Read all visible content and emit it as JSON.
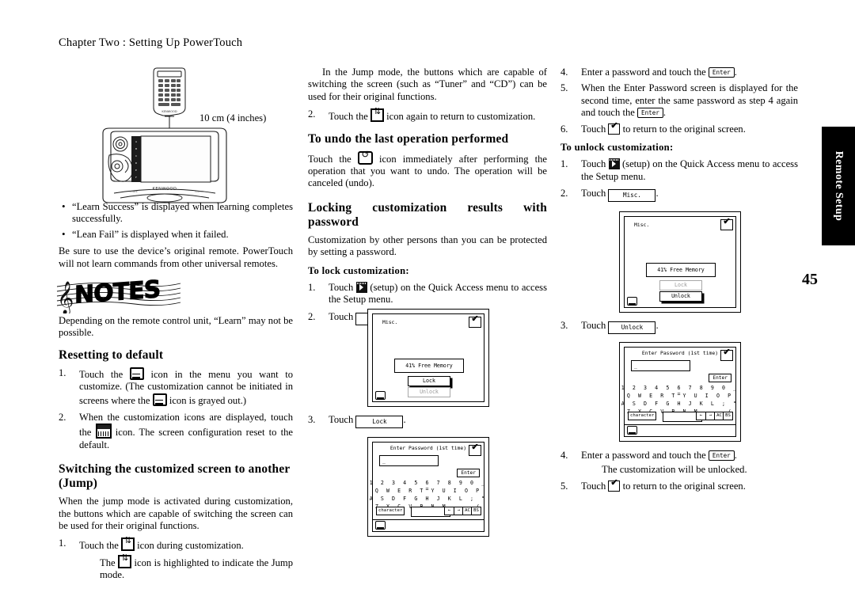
{
  "document": {
    "running_head": "Chapter Two : Setting Up PowerTouch",
    "page_number": "45",
    "side_tab": "Remote Setup"
  },
  "figure_remote": {
    "distance_label": "10 cm (4 inches)",
    "brand": "KENWOOD"
  },
  "left_column": {
    "bullets": [
      "“Learn Success” is displayed when learning completes successfully.",
      "“Lean Fail” is displayed when it failed."
    ],
    "note_paragraph": "Be sure to use the device’s original remote. PowerTouch will not learn commands from other universal remotes.",
    "notes_logo_text": "NOTES",
    "notes_body": "Depending on the remote control unit, “Learn” may not be possible.",
    "resetting": {
      "heading": "Resetting to default",
      "step1_a": "Touch the",
      "step1_b": "icon in the menu you want to customize. (The customization cannot be initiated in screens where the",
      "step1_c": "icon is grayed out.)",
      "step2_a": "When the customization icons are displayed, touch the",
      "step2_b": "icon. The screen configuration reset to the default.",
      "num1": "1.",
      "num2": "2."
    },
    "switching": {
      "heading_line1": "Switching the customized screen to another",
      "heading_line2": "(Jump)",
      "body": "When the jump mode is activated during customization, the buttons which are capable of switching the screen can be used for their original functions.",
      "num1": "1.",
      "step1_a": "Touch the",
      "step1_b": "icon during customization.",
      "sub_a": "The",
      "sub_b": "icon is highlighted to indicate the Jump mode."
    }
  },
  "mid_column": {
    "intro": "In the Jump mode, the buttons which are capable of switching the screen (such as “Tuner” and “CD”) can be used for their original functions.",
    "num2": "2.",
    "step2_a": "Touch the",
    "step2_b": "icon again to return to customization.",
    "undo": {
      "heading": "To undo the last operation performed",
      "body_a": "Touch the",
      "body_b": "icon immediately after performing the operation that you want to undo. The operation will be canceled (undo)."
    },
    "locking": {
      "heading": "Locking customization results with password",
      "body": "Customization by other persons than you can be protected by setting a password.",
      "subheading": "To lock customization:",
      "num1": "1.",
      "step1_a": "Touch",
      "step1_b": "(setup) on the Quick Access menu to access the Setup menu.",
      "num2": "2.",
      "step2_a": "Touch",
      "step2_btn": "Misc.",
      "step2_c": ".",
      "num3": "3.",
      "step3_a": "Touch",
      "step3_btn": "Lock",
      "step3_c": "."
    }
  },
  "right_column": {
    "steps": [
      {
        "num": "4.",
        "text_a": "Enter a password and touch the",
        "key": "Enter",
        "text_b": "."
      },
      {
        "num": "5.",
        "text_a": "When the Enter Password screen is displayed for the second time, enter the same password as step 4 again and touch the",
        "key": "Enter",
        "text_b": "."
      },
      {
        "num": "6.",
        "text_a": "Touch",
        "text_b": "to return to the original screen."
      }
    ],
    "unlock": {
      "subheading": "To unlock customization:",
      "num1": "1.",
      "step1_a": "Touch",
      "step1_b": "(setup) on the Quick Access menu to access the Setup menu.",
      "num2": "2.",
      "step2_a": "Touch",
      "step2_btn": "Misc.",
      "step2_c": ".",
      "num3": "3.",
      "step3_a": "Touch",
      "step3_btn": "Unlock",
      "step3_c": ".",
      "num4": "4.",
      "step4_a": "Enter a password and touch the",
      "step4_key": "Enter",
      "step4_b": ".",
      "step4_sub": "The customization will be unlocked.",
      "num5": "5.",
      "step5_a": "Touch",
      "step5_b": "to return to the original screen."
    }
  },
  "lcd_misc_lock": {
    "title": "Misc.",
    "memory": "41% Free Memory",
    "button_primary": "Lock",
    "button_secondary": "Unlock"
  },
  "lcd_misc_unlock": {
    "title": "Misc.",
    "memory": "41% Free Memory",
    "button_secondary": "Lock",
    "button_primary": "Unlock"
  },
  "lcd_keyboard": {
    "title": "Enter Password (1st time)",
    "field_value": "_",
    "enter_key": "Enter",
    "row1": "1 2 3 4 5 6 7 8 9 0 _ =",
    "row2": "Q W E R T Y U I O P",
    "row3": "A S D F G H J K L ; \"",
    "row4": "Z X C V B N M , . /",
    "key_character": "character",
    "key_left": "←",
    "key_right": "→",
    "key_ac": "AC",
    "key_bs": "BS"
  }
}
